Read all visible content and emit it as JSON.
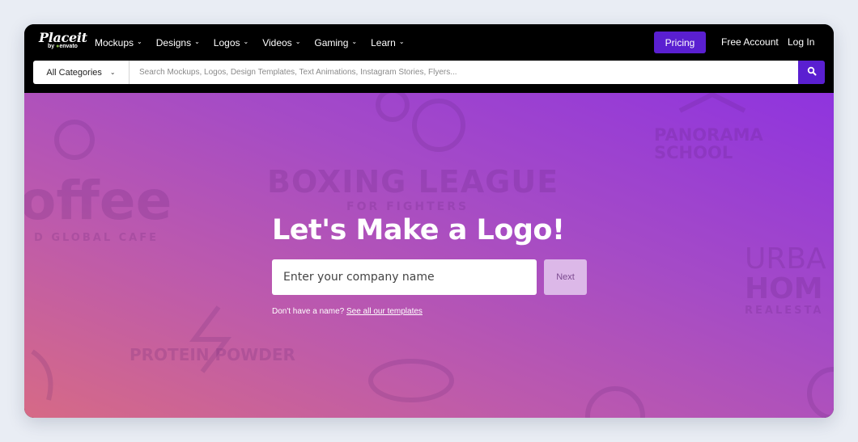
{
  "brand": {
    "logo_text": "Placeit",
    "logo_sub_prefix": "by ",
    "logo_sub_name": "envato"
  },
  "nav": {
    "items": [
      {
        "label": "Mockups"
      },
      {
        "label": "Designs"
      },
      {
        "label": "Logos"
      },
      {
        "label": "Videos"
      },
      {
        "label": "Gaming"
      },
      {
        "label": "Learn"
      }
    ],
    "pricing_label": "Pricing",
    "free_account_label": "Free Account",
    "login_label": "Log In"
  },
  "search": {
    "category_label": "All Categories",
    "placeholder": "Search Mockups, Logos, Design Templates, Text Animations, Instagram Stories, Flyers...",
    "button_icon": "search-icon"
  },
  "hero": {
    "title": "Let's Make a Logo!",
    "input_placeholder": "Enter your company name",
    "next_label": "Next",
    "hint_text": "Don't have a name?",
    "hint_link": "See all our templates"
  },
  "background_art": {
    "texts": [
      "offee",
      "D GLOBAL CAFE",
      "BOXING LEAGUE",
      "FOR FIGHTERS",
      "PANORAMA",
      "SCHOOL",
      "URBA",
      "HOM",
      "REALESTA",
      "PROTEIN POWDER"
    ]
  },
  "colors": {
    "accent": "#5a1fd1",
    "topbar": "#000000",
    "hero_gradient_start": "#d66a86",
    "hero_gradient_end": "#8f34de",
    "next_button": "#dcb8e8",
    "page_background": "#e9edf4"
  }
}
